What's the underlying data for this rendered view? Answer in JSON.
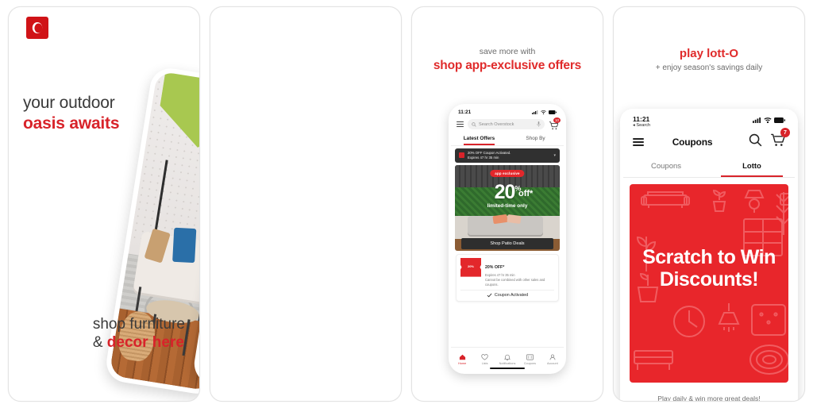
{
  "brand": {
    "name": "Overstock",
    "logo_icon": "overstock-o-logo",
    "red": "#d8232a",
    "dark_red": "#e8262b",
    "green": "#a8c850"
  },
  "panel1": {
    "headline_line1": "your outdoor",
    "headline_line2": "oasis awaits",
    "footer_line1": "shop furniture",
    "footer_line2_prefix": "& ",
    "footer_line2": "decor here"
  },
  "panel3": {
    "caption_small": "save more with",
    "caption_big": "shop app-exclusive offers",
    "phone": {
      "status_time": "11:21",
      "search_placeholder": "Search Overstock",
      "cart_badge": "10",
      "tabs": [
        {
          "label": "Latest Offers",
          "active": true
        },
        {
          "label": "Shop By",
          "active": false
        }
      ],
      "coupon_bar": {
        "line1": "20% OFF Coupon Activated.",
        "line2": "Expires 47 hr 35 min"
      },
      "hero": {
        "badge": "app exclusive",
        "percent": "20",
        "percent_sup": "%",
        "off": "off*",
        "limited": "limited-time only",
        "cta": "Shop Patio Deals"
      },
      "coupon_card": {
        "ticket_line1": "20%",
        "ticket_line2": "OFF",
        "title": "20% OFF*",
        "expires": "Expires 47 hr 35 min",
        "terms": "Cannot be combined with other sales and coupons.",
        "activated": "Coupon Activated",
        "check_icon": "check-icon"
      },
      "nav": [
        {
          "label": "Home",
          "icon": "home-icon",
          "active": true
        },
        {
          "label": "Lists",
          "icon": "heart-icon",
          "active": false
        },
        {
          "label": "Notifications",
          "icon": "bell-icon",
          "active": false
        },
        {
          "label": "Coupons",
          "icon": "coupon-icon",
          "active": false
        },
        {
          "label": "Account",
          "icon": "person-icon",
          "active": false
        }
      ]
    }
  },
  "panel4": {
    "caption_big": "play lott-O",
    "caption_sub": "+ enjoy season's savings daily",
    "phone": {
      "status_time": "11:21",
      "back_label": "Search",
      "title": "Coupons",
      "cart_badge": "7",
      "menu_icon": "hamburger-icon",
      "search_icon": "search-icon",
      "cart_icon": "cart-icon",
      "tabs": [
        {
          "label": "Coupons",
          "active": false
        },
        {
          "label": "Lotto",
          "active": true
        }
      ],
      "card_line1": "Scratch to Win",
      "card_line2": "Discounts!",
      "footer": "Play daily & win more great deals!"
    }
  }
}
